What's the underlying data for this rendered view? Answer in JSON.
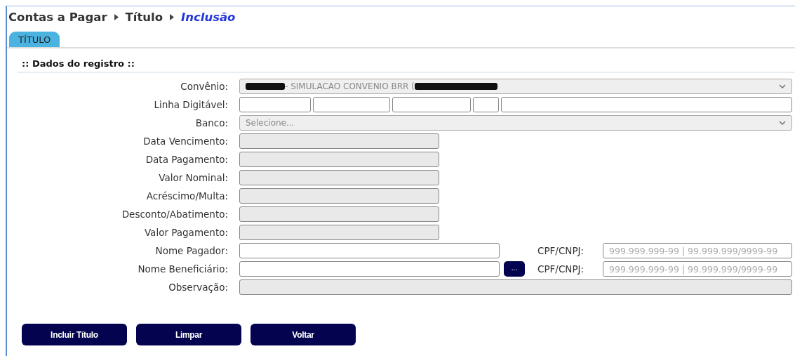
{
  "breadcrumb": [
    {
      "label": "Contas a Pagar",
      "current": false
    },
    {
      "label": "Título",
      "current": false
    },
    {
      "label": "Inclusão",
      "current": true
    }
  ],
  "tabs": [
    {
      "label": "TÍTULO",
      "selected": true
    }
  ],
  "section_title": ":: Dados do registro ::",
  "fields": [
    {
      "kind": "select",
      "label": "Convênio:",
      "value": "- SIMULACAO CONVENIO BRR (",
      "redacted": true
    },
    {
      "kind": "split",
      "label": "Linha Digitável:"
    },
    {
      "kind": "select",
      "label": "Banco:",
      "placeholder": "Selecione..."
    },
    {
      "kind": "readonly",
      "label": "Data Vencimento:"
    },
    {
      "kind": "readonly",
      "label": "Data Pagamento:"
    },
    {
      "kind": "readonly",
      "label": "Valor Nominal:"
    },
    {
      "kind": "readonly",
      "label": "Acréscimo/Multa:"
    },
    {
      "kind": "readonly",
      "label": "Desconto/Abatimento:"
    },
    {
      "kind": "readonly",
      "label": "Valor Pagamento:"
    },
    {
      "kind": "text",
      "label": "Nome Pagador:",
      "doc_label": "CPF/CNPJ:",
      "doc_placeholder": "999.999.999-99 | 99.999.999/9999-99"
    },
    {
      "kind": "text",
      "label": "Nome Beneficiário:",
      "lookup": "...",
      "doc_label": "CPF/CNPJ:",
      "doc_placeholder": "999.999.999-99 | 99.999.999/9999-99"
    },
    {
      "kind": "wide",
      "label": "Observação:"
    }
  ],
  "buttons": [
    "Incluir Título",
    "Limpar",
    "Voltar"
  ]
}
